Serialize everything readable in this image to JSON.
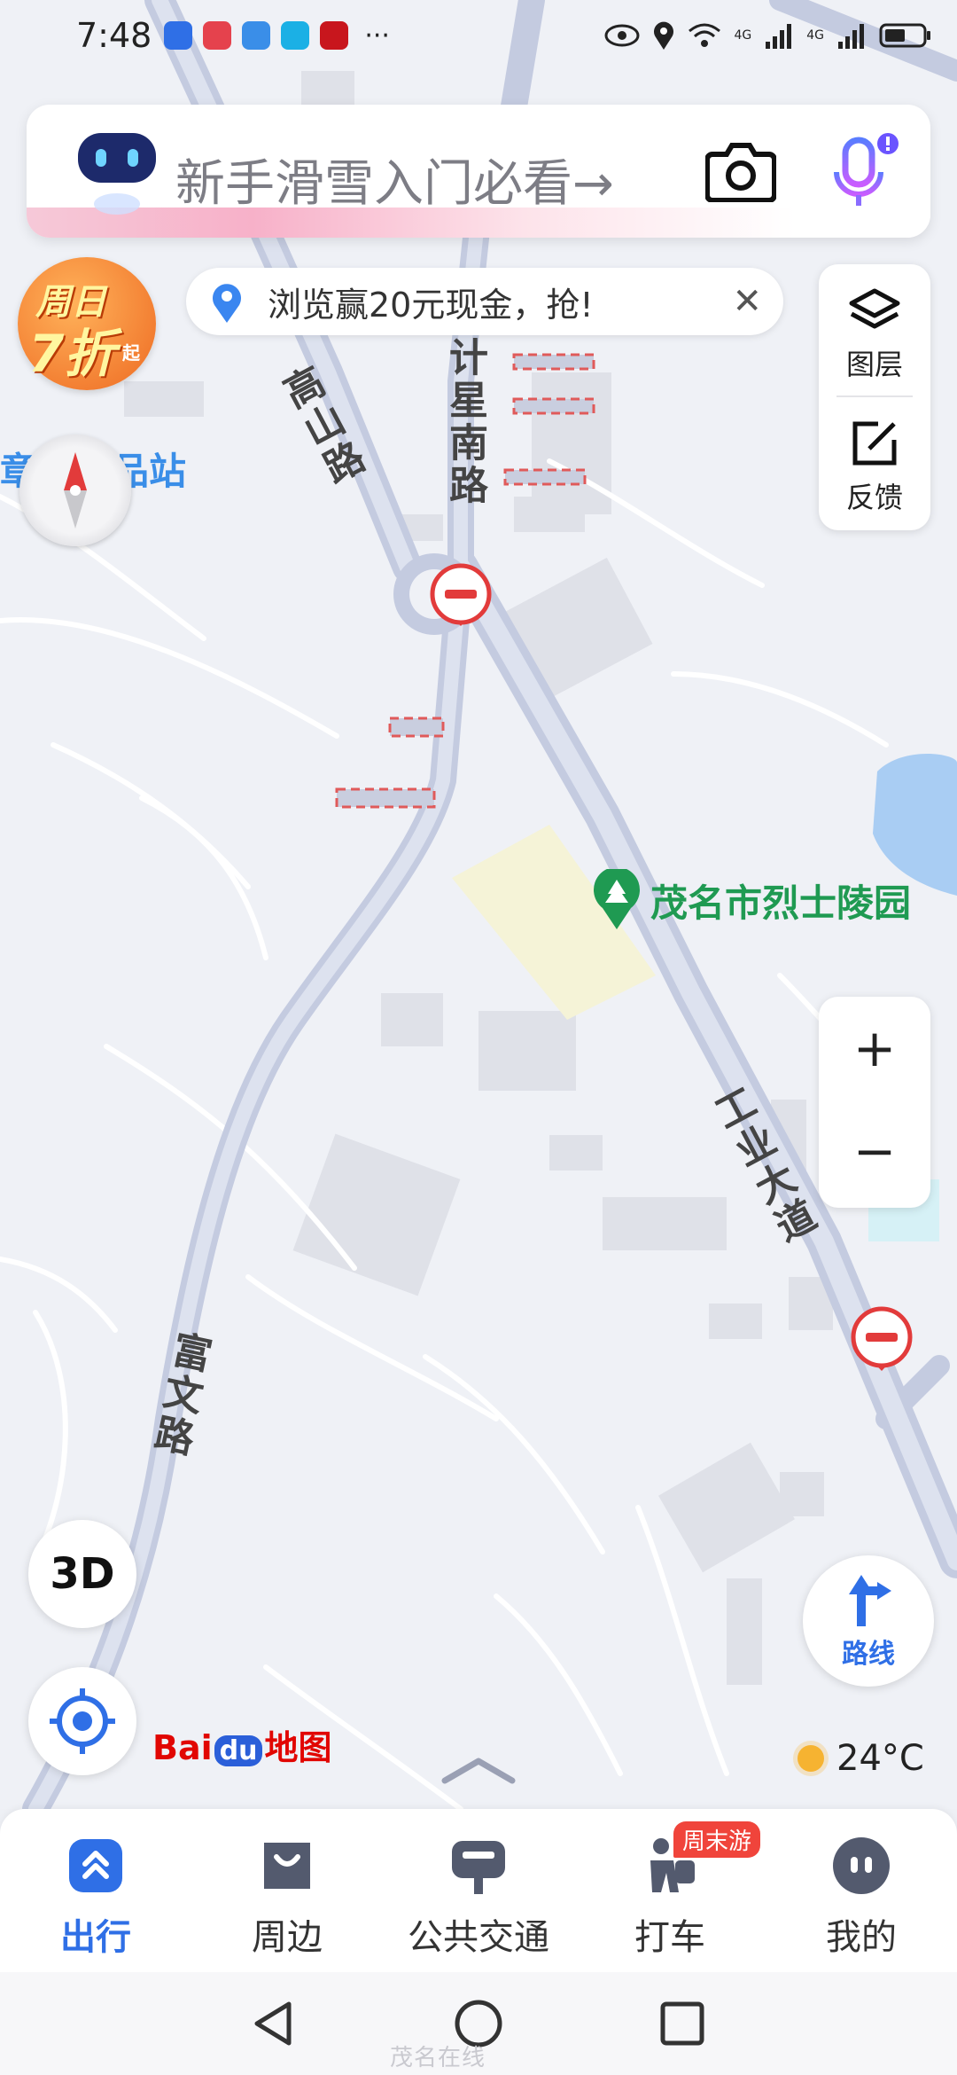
{
  "status_bar": {
    "time": "7:48",
    "more": "···",
    "network_1": "4G",
    "network_2": "4G",
    "icons": [
      "bulb-app-icon",
      "huawei-app-icon",
      "cloud-app-icon",
      "search-app-icon",
      "xuexi-app-icon",
      "eye-icon",
      "location-icon",
      "wifi-icon",
      "signal-icon",
      "signal-icon",
      "battery-icon"
    ]
  },
  "search": {
    "placeholder": "新手滑雪入门必看→",
    "icons": [
      "robot-assistant-icon",
      "camera-icon",
      "microphone-icon"
    ]
  },
  "promo": {
    "line1": "周日",
    "line2": "7折",
    "line3": "起"
  },
  "notice": {
    "text": "浏览赢20元现金，抢!",
    "close": "✕"
  },
  "side_panel": {
    "layers_label": "图层",
    "feedback_label": "反馈"
  },
  "map": {
    "roads": {
      "gaoshan": "高山路",
      "jixing": "计星南路",
      "gongye": "工业大道",
      "fuwen": "富文路"
    },
    "poi": {
      "name": "茂名市烈士陵园",
      "waste_station": "章锋废品站"
    }
  },
  "zoom": {
    "in": "+",
    "out": "−"
  },
  "controls": {
    "three_d": "3D",
    "route_label": "路线"
  },
  "brand": {
    "bai": "Bai",
    "du": "du",
    "ditu": "地图"
  },
  "weather": {
    "temp": "24°C"
  },
  "tabs": [
    {
      "label": "出行",
      "active": true
    },
    {
      "label": "周边"
    },
    {
      "label": "公共交通"
    },
    {
      "label": "打车",
      "badge": "周末游"
    },
    {
      "label": "我的"
    }
  ],
  "watermark": "茂名在线",
  "colors": {
    "accent": "#2f6fe6",
    "road": "#c4cbe0",
    "park": "#1f9a52",
    "badge": "#f0443b"
  }
}
